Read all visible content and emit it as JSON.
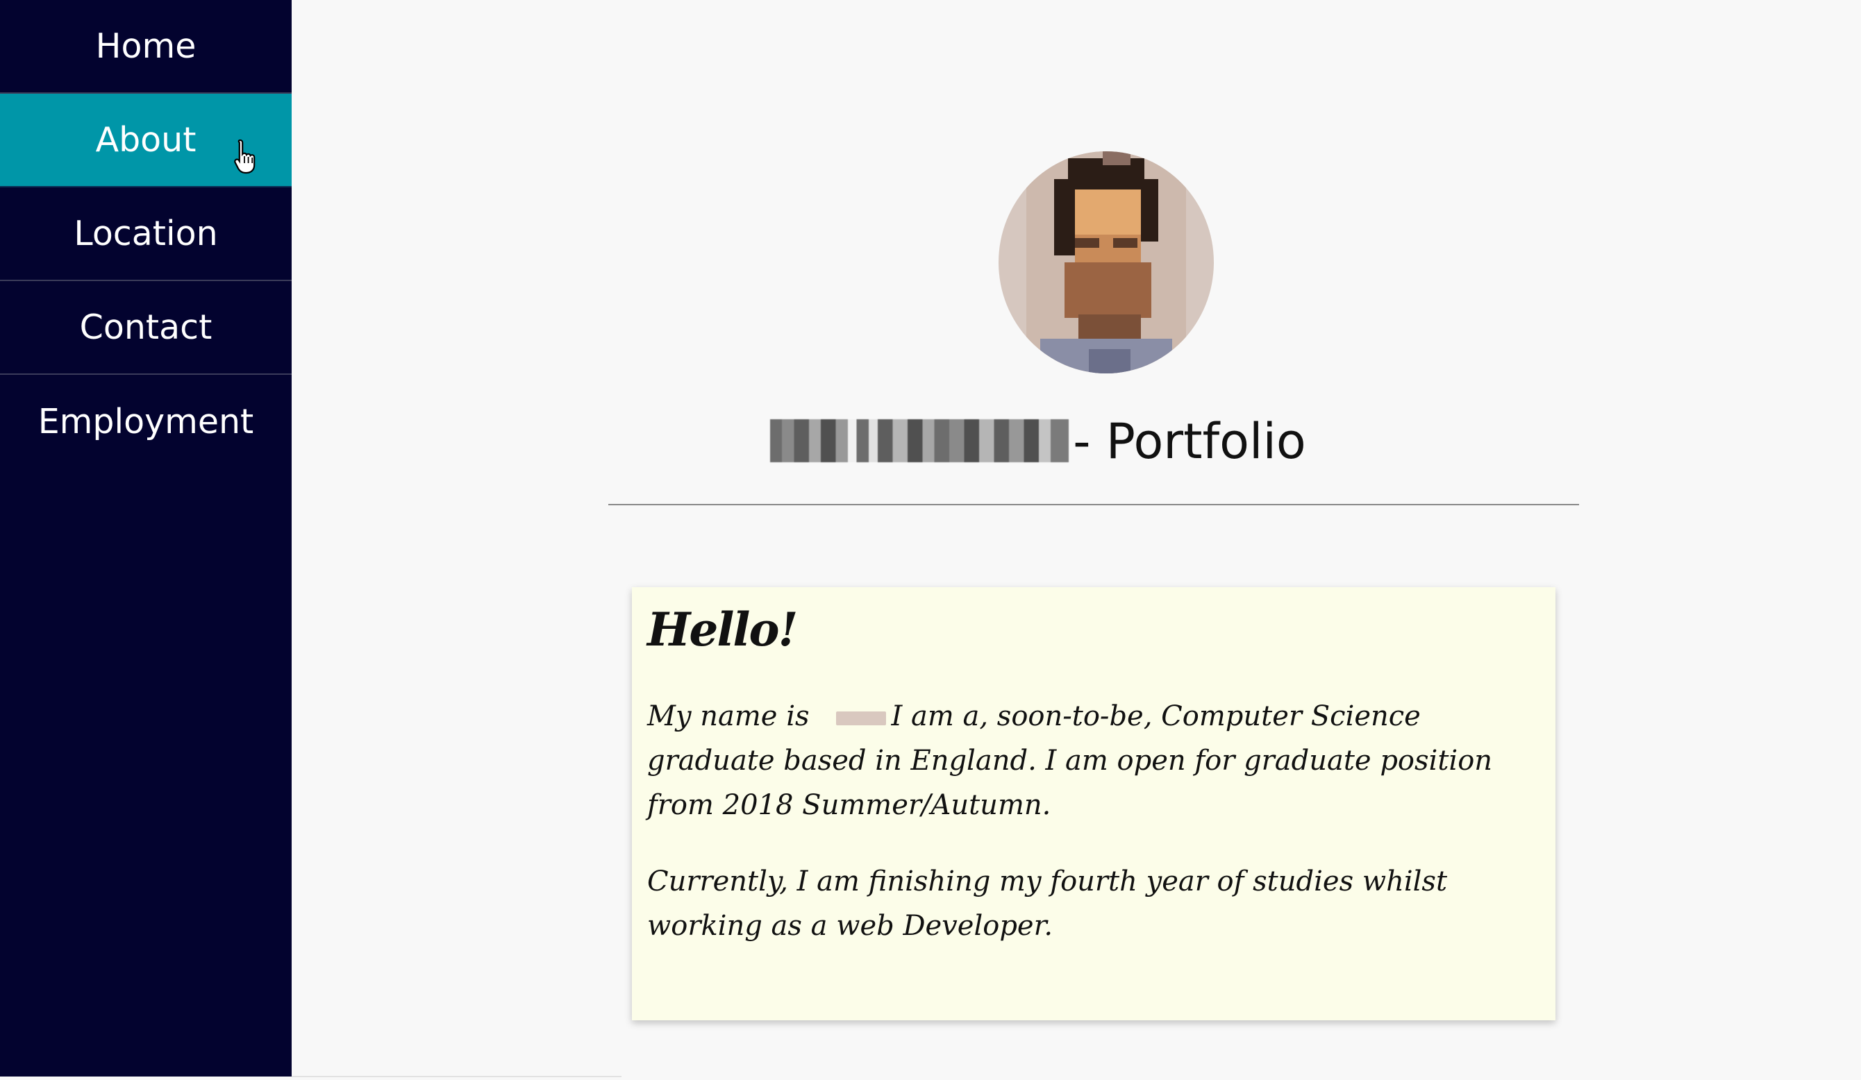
{
  "nav": {
    "items": [
      {
        "label": "Home"
      },
      {
        "label": "About"
      },
      {
        "label": "Location"
      },
      {
        "label": "Contact"
      },
      {
        "label": "Employment"
      }
    ],
    "active_index": 1
  },
  "header": {
    "title_suffix": "- Portfolio"
  },
  "card": {
    "heading": "Hello!",
    "p1_before": "My name is",
    "p1_after": "I am a, soon-to-be, Computer Science graduate based in England. I am open for graduate position from 2018 Summer/Autumn.",
    "p2": "Currently, I am finishing my fourth year of studies whilst working as a web Developer."
  },
  "colors": {
    "sidebar_bg": "#03032f",
    "active_bg": "#0096a8",
    "card_bg": "#fcfde9",
    "page_bg": "#f8f8f8"
  }
}
